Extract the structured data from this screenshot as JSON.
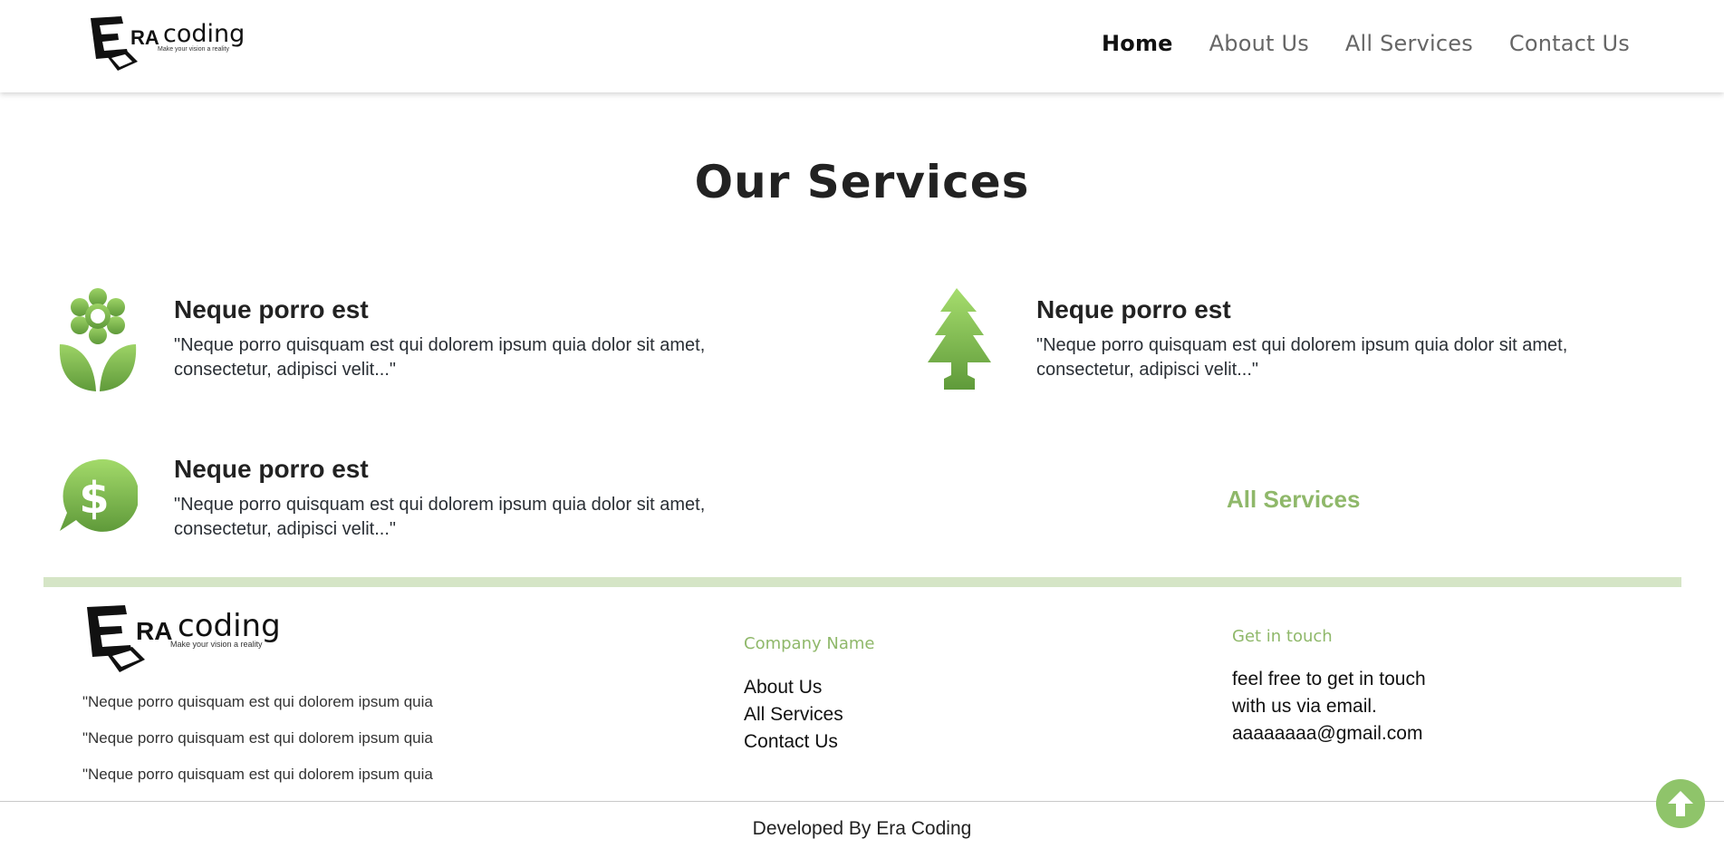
{
  "header": {
    "logo_text": "ERAcoding",
    "logo_tagline": "Make your vision a reality",
    "nav": [
      {
        "label": "Home"
      },
      {
        "label": "About Us"
      },
      {
        "label": "All Services"
      },
      {
        "label": "Contact Us"
      }
    ]
  },
  "services": {
    "title": "Our Services",
    "items": [
      {
        "icon": "flower-icon",
        "title": "Neque porro est",
        "line1": "\"Neque porro quisquam est qui dolorem ipsum quia dolor sit amet,",
        "line2": "consectetur, adipisci velit...\""
      },
      {
        "icon": "tree-icon",
        "title": "Neque porro est",
        "line1": "\"Neque porro quisquam est qui dolorem ipsum quia dolor sit amet,",
        "line2": "consectetur, adipisci velit...\""
      },
      {
        "icon": "dollar-chat-icon",
        "title": "Neque porro est",
        "line1": "\"Neque porro quisquam est qui dolorem ipsum quia dolor sit amet,",
        "line2": "consectetur, adipisci velit...\""
      }
    ],
    "all_services_link": "All Services"
  },
  "footer": {
    "logo_text": "ERAcoding",
    "logo_tagline": "Make your vision a reality",
    "lines": [
      "\"Neque porro quisquam est qui dolorem ipsum quia",
      "\"Neque porro quisquam est qui dolorem ipsum quia",
      "\"Neque porro quisquam est qui dolorem ipsum quia"
    ],
    "company_heading": "Company Name",
    "links": [
      {
        "label": "About Us"
      },
      {
        "label": "All Services"
      },
      {
        "label": "Contact Us"
      }
    ],
    "contact_heading": "Get in touch",
    "contact_line1": "feel free to get in touch",
    "contact_line2": "with us via email.",
    "email": "aaaaaaaa@gmail.com",
    "credit": "Developed By Era Coding"
  },
  "colors": {
    "accent": "#8fb86a",
    "divider": "#d5e5c6",
    "scroll_button": "#8fc46a"
  }
}
